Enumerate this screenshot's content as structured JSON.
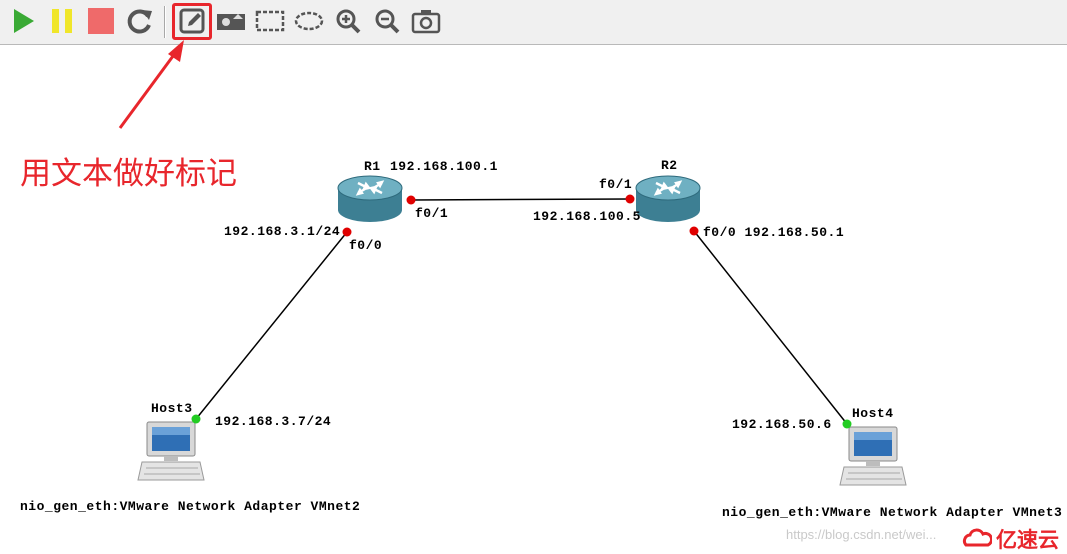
{
  "toolbar": {
    "buttons": [
      {
        "name": "start-all-button",
        "icon": "play-icon",
        "color": "#3aaa35"
      },
      {
        "name": "suspend-all-button",
        "icon": "pause-icon",
        "color": "#f0e62a"
      },
      {
        "name": "stop-all-button",
        "icon": "stop-icon",
        "color": "#ef6a6a"
      },
      {
        "name": "reload-all-button",
        "icon": "reload-icon",
        "color": "#555555"
      },
      {
        "name": "add-note-button",
        "icon": "note-pencil-icon",
        "color": "#555555",
        "highlighted": true
      },
      {
        "name": "insert-picture-button",
        "icon": "picture-icon",
        "color": "#555555"
      },
      {
        "name": "draw-rectangle-button",
        "icon": "dashed-rectangle-icon",
        "color": "#555555"
      },
      {
        "name": "draw-ellipse-button",
        "icon": "dashed-ellipse-icon",
        "color": "#555555"
      },
      {
        "name": "zoom-in-button",
        "icon": "zoom-in-icon",
        "color": "#555555"
      },
      {
        "name": "zoom-out-button",
        "icon": "zoom-out-icon",
        "color": "#555555"
      },
      {
        "name": "screenshot-button",
        "icon": "camera-icon",
        "color": "#555555"
      }
    ]
  },
  "annotation": {
    "text": "用文本做好标记",
    "color": "#e8262c"
  },
  "topology": {
    "link_color": "#000000",
    "port_color": "#e00000",
    "host_port_color": "#22cc22",
    "routers": [
      {
        "id": "R1",
        "name": "R1",
        "ip_label": "192.168.100.1"
      },
      {
        "id": "R2",
        "name": "R2",
        "ip_label": ""
      }
    ],
    "hosts": [
      {
        "id": "Host3",
        "name": "Host3",
        "adapter": "nio_gen_eth:VMware Network Adapter VMnet2"
      },
      {
        "id": "Host4",
        "name": "Host4",
        "adapter": "nio_gen_eth:VMware Network Adapter VMnet3"
      }
    ],
    "labels": {
      "r1_f01": "f0/1",
      "r2_f01": "f0/1",
      "r2_ip_f01": "192.168.100.5",
      "r1_f00_ip": "192.168.3.1/24",
      "r1_f00": "f0/0",
      "r2_f00": "f0/0 192.168.50.1",
      "host3_ip": "192.168.3.7/24",
      "host4_ip": "192.168.50.6"
    }
  },
  "watermark": {
    "text": "https://blog.csdn.net/wei...",
    "logo_text": "亿速云"
  }
}
